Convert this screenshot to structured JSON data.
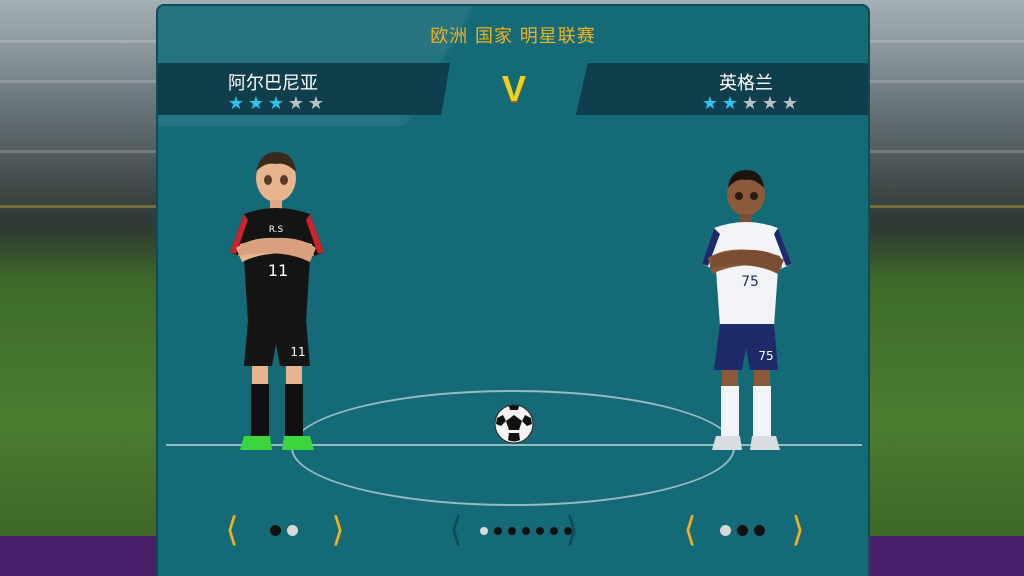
{
  "league_title": "欧洲 国家 明星联赛",
  "vs_label": "V",
  "home_team": {
    "name": "阿尔巴尼亚",
    "rating": 3,
    "max_rating": 5,
    "jersey_number": "11",
    "jersey_chest": "R.S",
    "kit_colors": {
      "shirt": "#141414",
      "shorts": "#141414",
      "accent": "#c8242a",
      "boots": "#3cd63c"
    },
    "kit_pager": {
      "dots": 2,
      "active_index": 1
    }
  },
  "away_team": {
    "name": "英格兰",
    "rating": 2,
    "max_rating": 5,
    "jersey_number": "75",
    "kit_colors": {
      "shirt": "#f2f4f8",
      "shorts": "#1e2a6a",
      "accent": "#1e2a6a",
      "boots": "#d8dde2"
    },
    "kit_pager": {
      "dots": 3,
      "active_index": 0
    }
  },
  "center_pager": {
    "dots": 7,
    "active_index": 0
  },
  "icons": {
    "prev": "chevron-left-icon",
    "next": "chevron-right-icon",
    "star": "star-icon"
  },
  "colors": {
    "panel": "#156a78",
    "banner": "#0f3f4d",
    "title": "#f0b21e",
    "star_on": "#2ec4f0",
    "star_off": "#b8c0c4"
  }
}
